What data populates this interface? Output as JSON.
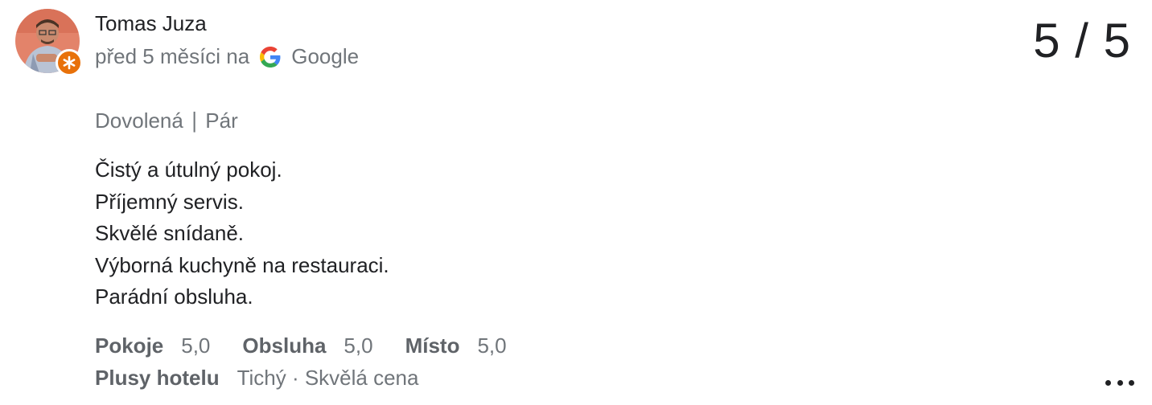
{
  "review": {
    "author": "Tomas Juza",
    "time": "před 5 měsíci na",
    "source": "Google",
    "score": "5 / 5",
    "trip_info": "Dovolená ∣ Pár",
    "text_lines": [
      "Čistý a útulný pokoj.",
      "Příjemný servis.",
      "Skvělé snídaně.",
      "Výborná kuchyně na restauraci.",
      "Parádní obsluha."
    ],
    "ratings": [
      {
        "label": "Pokoje",
        "value": "5,0"
      },
      {
        "label": "Obsluha",
        "value": "5,0"
      },
      {
        "label": "Místo",
        "value": "5,0"
      }
    ],
    "highlights": {
      "label": "Plusy hotelu",
      "value": "Tichý · Skvělá cena"
    }
  },
  "icons": {
    "avatar": "user-avatar-photo",
    "badge": "local-guide-badge-icon",
    "source": "google-g-icon",
    "more": "more-horizontal-icon"
  },
  "colors": {
    "badge": "#e8710a",
    "secondary_text": "#70757a",
    "primary_text": "#202124"
  }
}
